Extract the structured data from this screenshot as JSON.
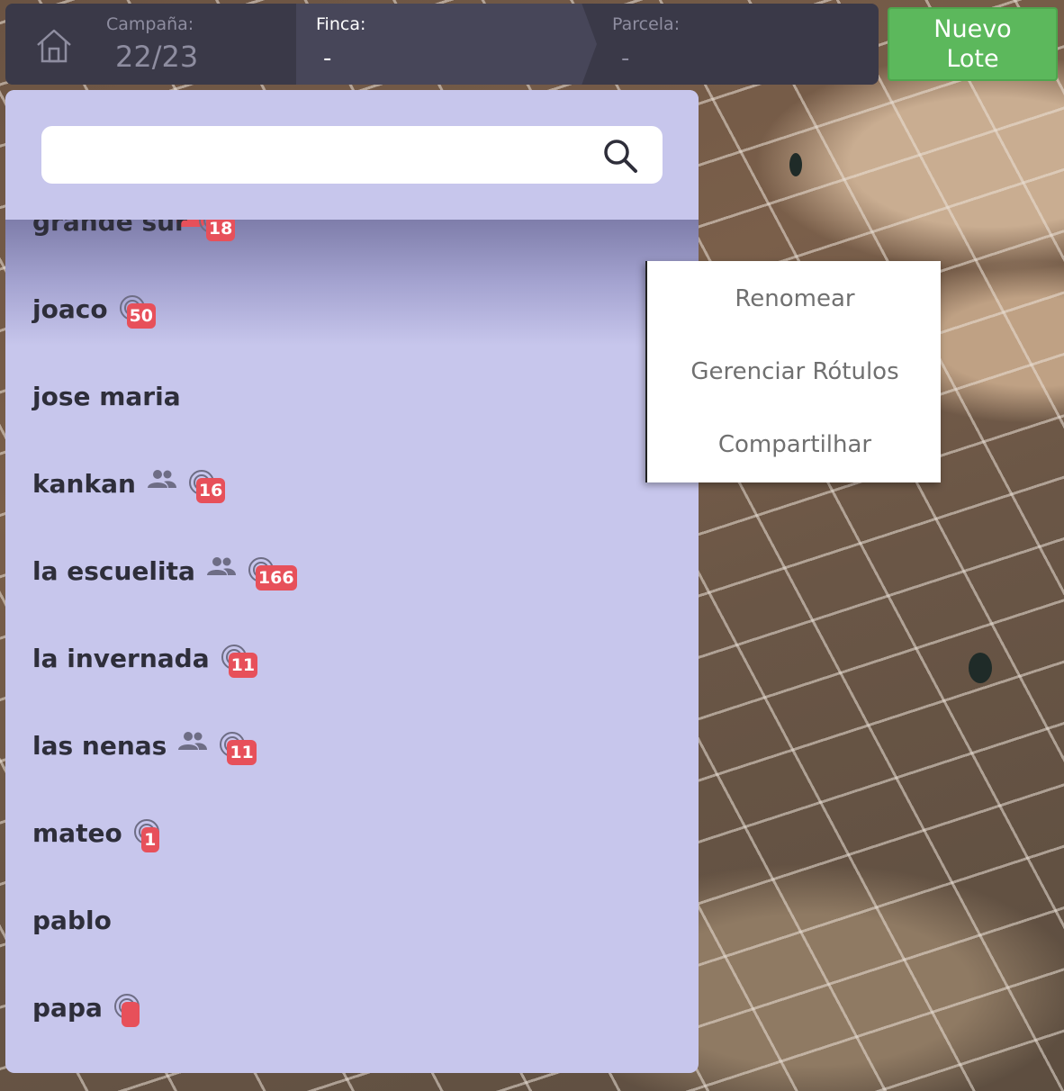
{
  "header": {
    "campana": {
      "label": "Campaña:",
      "value": "22/23"
    },
    "finca": {
      "label": "Finca:",
      "value": "-"
    },
    "parcela": {
      "label": "Parcela:",
      "value": "-"
    },
    "new_button": {
      "line1": "Nuevo",
      "line2": "Lote"
    }
  },
  "search": {
    "value": "",
    "placeholder": ""
  },
  "lots": [
    {
      "name": "grande sur",
      "shared": false,
      "count": "18"
    },
    {
      "name": "joaco",
      "shared": false,
      "count": "50"
    },
    {
      "name": "jose maria",
      "shared": false,
      "count": null
    },
    {
      "name": "kankan",
      "shared": true,
      "count": "16"
    },
    {
      "name": "la escuelita",
      "shared": true,
      "count": "166"
    },
    {
      "name": "la invernada",
      "shared": false,
      "count": "11"
    },
    {
      "name": "las nenas",
      "shared": true,
      "count": "11"
    },
    {
      "name": "mateo",
      "shared": false,
      "count": "1"
    },
    {
      "name": "pablo",
      "shared": false,
      "count": null
    },
    {
      "name": "papa",
      "shared": false,
      "count": ""
    }
  ],
  "context_menu": {
    "items": [
      "Renomear",
      "Gerenciar Rótulos",
      "Compartilhar"
    ]
  },
  "icons": {
    "home": "home-icon",
    "search": "search-icon",
    "shared": "people-icon",
    "target": "target-icon"
  },
  "colors": {
    "header_bg": "#3a3948",
    "panel_bg": "#c7c6ec",
    "new_button": "#5cb85c",
    "badge": "#e7505a"
  }
}
